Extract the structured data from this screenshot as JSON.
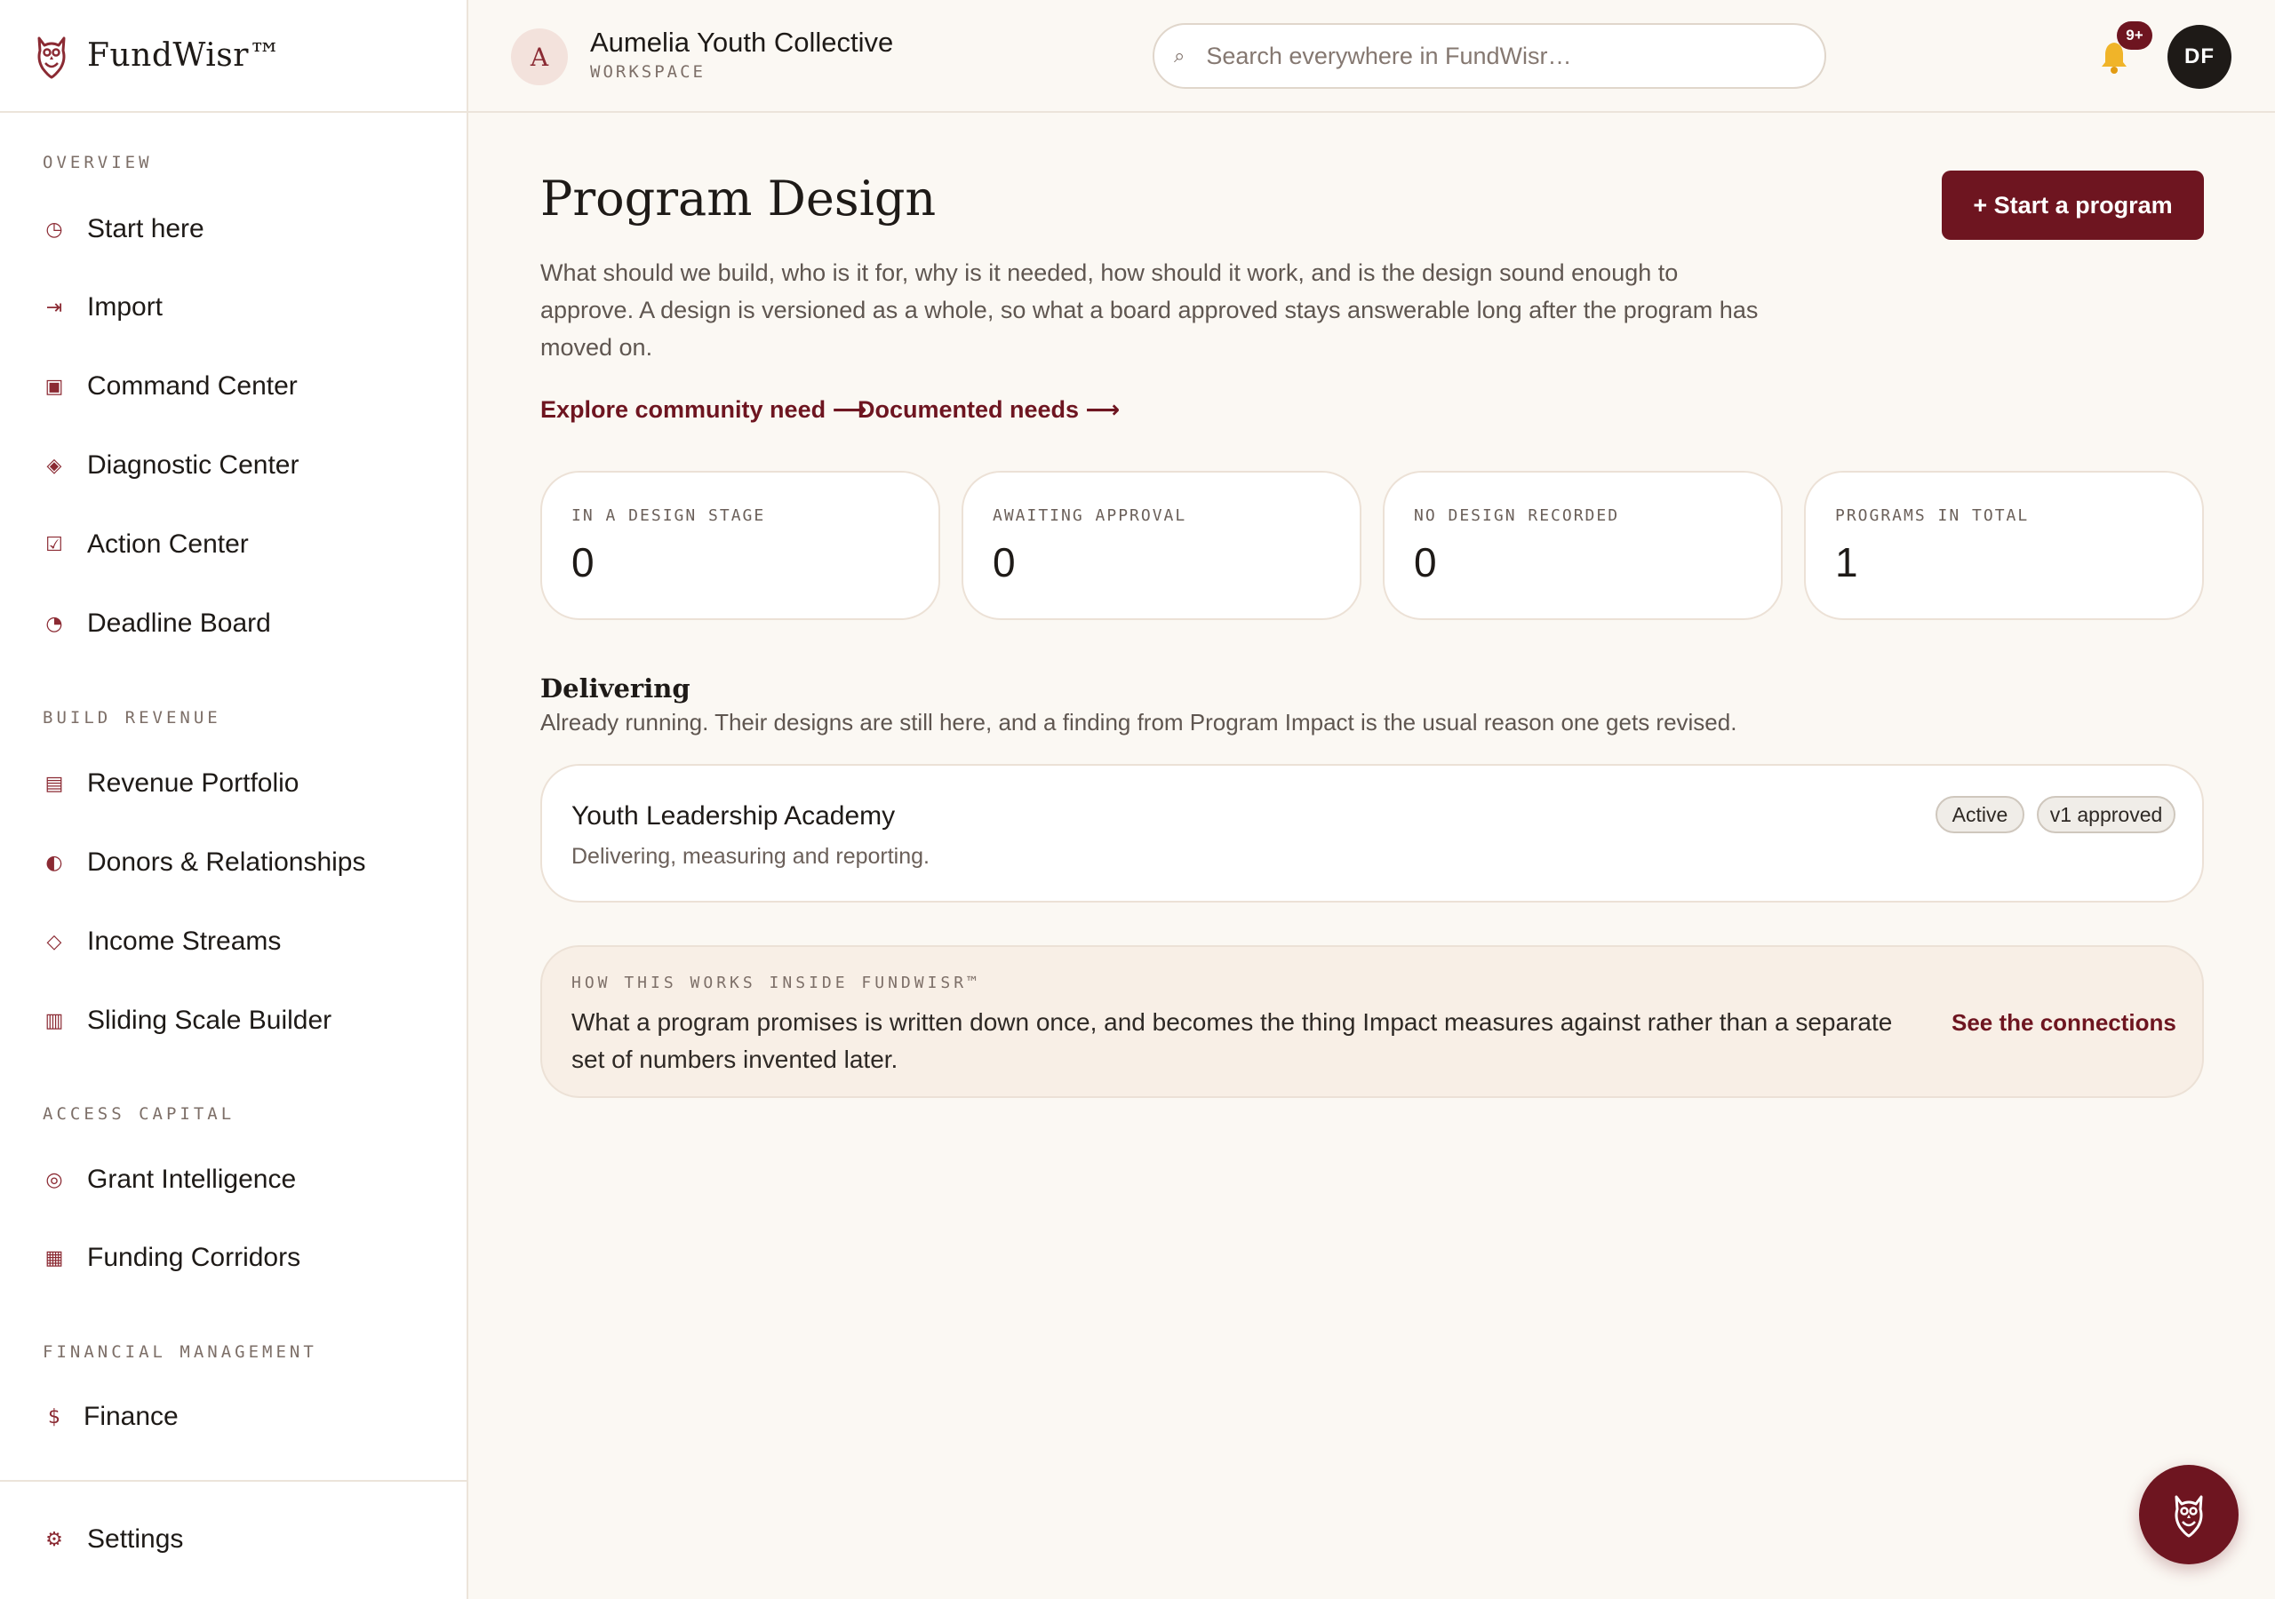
{
  "brand": {
    "name": "FundWisr™"
  },
  "workspace": {
    "initial": "A",
    "name": "Aumelia Youth Collective",
    "sub": "WORKSPACE"
  },
  "search": {
    "placeholder": "Search everywhere in FundWisr…"
  },
  "notifications": {
    "badge": "9+"
  },
  "user": {
    "initials": "DF"
  },
  "sidebar": {
    "sections": [
      {
        "title": "OVERVIEW"
      },
      {
        "title": "BUILD REVENUE"
      },
      {
        "title": "ACCESS CAPITAL"
      },
      {
        "title": "FINANCIAL MANAGEMENT"
      }
    ],
    "items": [
      {
        "label": "Start here",
        "icon": "◷"
      },
      {
        "label": "Import",
        "icon": "⇥"
      },
      {
        "label": "Command Center",
        "icon": "▣"
      },
      {
        "label": "Diagnostic Center",
        "icon": "◈"
      },
      {
        "label": "Action Center",
        "icon": "☑"
      },
      {
        "label": "Deadline Board",
        "icon": "◔"
      },
      {
        "label": "Revenue Portfolio",
        "icon": "▤"
      },
      {
        "label": "Donors & Relationships",
        "icon": "◐"
      },
      {
        "label": "Income Streams",
        "icon": "◇"
      },
      {
        "label": "Sliding Scale Builder",
        "icon": "▥"
      },
      {
        "label": "Grant Intelligence",
        "icon": "◎"
      },
      {
        "label": "Funding Corridors",
        "icon": "▦"
      },
      {
        "label": "Finance",
        "icon": "$"
      }
    ],
    "settings": {
      "label": "Settings",
      "icon": "⚙"
    }
  },
  "main": {
    "title": "Program Design",
    "primary_button": "+ Start a program",
    "intro": "What should we build, who is it for, why is it needed, how should it work, and is the design sound enough to approve. A design is versioned as a whole, so what a board approved stays answerable long after the program has moved on.",
    "links": [
      "Explore community need ⟶",
      "Documented needs ⟶"
    ],
    "stats": [
      {
        "label": "IN A DESIGN STAGE",
        "value": "0"
      },
      {
        "label": "AWAITING APPROVAL",
        "value": "0"
      },
      {
        "label": "NO DESIGN RECORDED",
        "value": "0"
      },
      {
        "label": "PROGRAMS IN TOTAL",
        "value": "1"
      }
    ],
    "section": {
      "title": "Delivering",
      "description": "Already running. Their designs are still here, and a finding from Program Impact is the usual reason one gets revised."
    },
    "program": {
      "name": "Youth Leadership Academy",
      "subtitle": "Delivering, measuring and reporting.",
      "tags": [
        "Active",
        "v1 approved"
      ]
    },
    "info": {
      "kicker": "HOW THIS WORKS INSIDE FUNDWISR™",
      "text": "What a program promises is written down once, and becomes the thing Impact measures against rather than a separate set of numbers invented later.",
      "link": "See the connections"
    }
  },
  "colors": {
    "accent": "#6e1520",
    "background": "#fbf8f3",
    "card": "#ffffff",
    "info_card": "#f8efe6"
  }
}
